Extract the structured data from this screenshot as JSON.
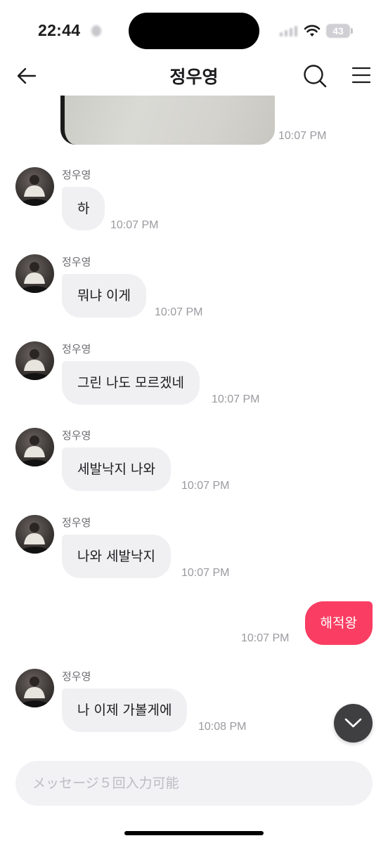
{
  "status_bar": {
    "time": "22:44",
    "battery": "43"
  },
  "header": {
    "title": "정우영",
    "back_icon": "arrow-left-icon",
    "search_icon": "search-icon",
    "menu_icon": "hamburger-menu-icon"
  },
  "chat": {
    "image_message_time": "10:07 PM",
    "messages": [
      {
        "direction": "in",
        "sender": "정우영",
        "text": "하",
        "time": "10:07 PM"
      },
      {
        "direction": "in",
        "sender": "정우영",
        "text": "뭐냐 이게",
        "time": "10:07 PM"
      },
      {
        "direction": "in",
        "sender": "정우영",
        "text": "그린 나도 모르겠네",
        "time": "10:07 PM"
      },
      {
        "direction": "in",
        "sender": "정우영",
        "text": "세발낙지 나와",
        "time": "10:07 PM"
      },
      {
        "direction": "in",
        "sender": "정우영",
        "text": "나와 세발낙지",
        "time": "10:07 PM"
      },
      {
        "direction": "out",
        "text": "해적왕",
        "time": "10:07 PM"
      },
      {
        "direction": "in",
        "sender": "정우영",
        "text": "나 이제 가볼게에",
        "time": "10:08 PM"
      }
    ],
    "scroll_down_icon": "chevron-down-icon"
  },
  "composer": {
    "placeholder": "メッセージ５回入力可能",
    "value": ""
  },
  "colors": {
    "outgoing_bubble": "#fa3d62",
    "incoming_bubble": "#f0f0f3",
    "timestamp": "#9a9aa0"
  }
}
